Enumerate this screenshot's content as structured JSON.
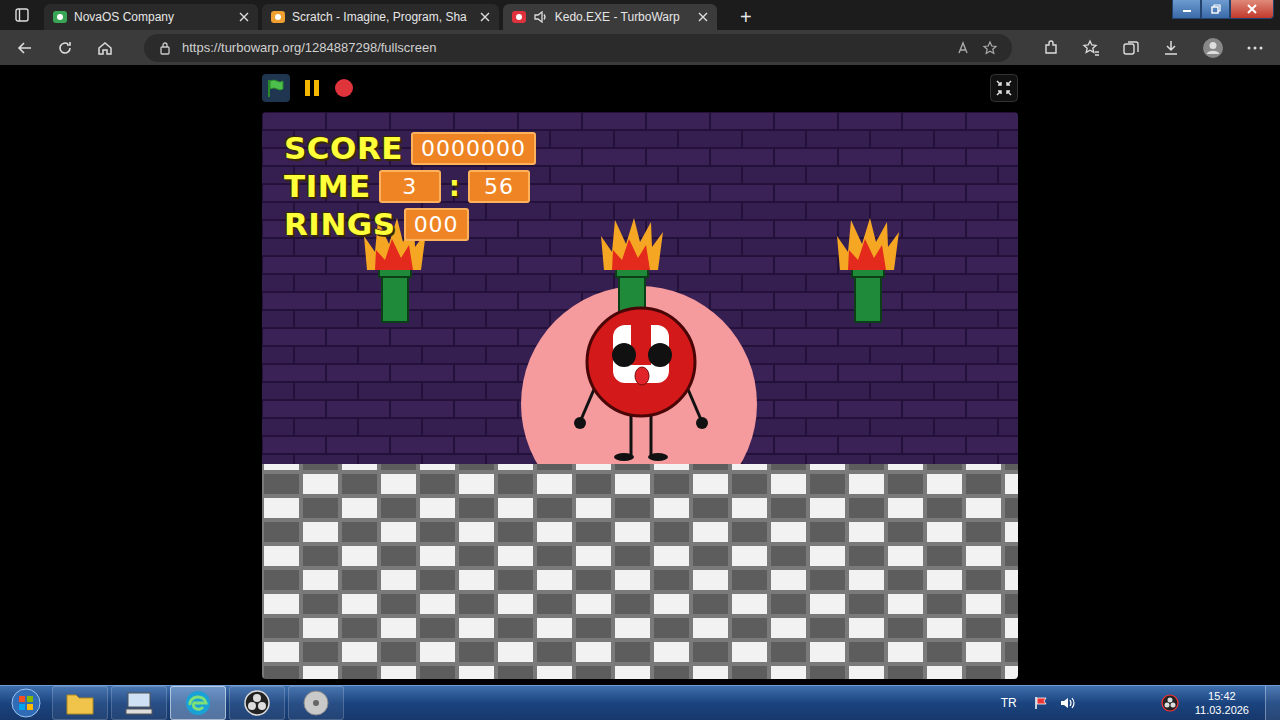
{
  "tabs": [
    {
      "label": "NovaOS Company",
      "selected": false,
      "audio": false,
      "color": "#3aa655"
    },
    {
      "label": "Scratch - Imagine, Program, Sha",
      "selected": false,
      "audio": false,
      "color": "#f0a030"
    },
    {
      "label": "Kedo.EXE - TurboWarp",
      "selected": true,
      "audio": true,
      "color": "#e0323c"
    }
  ],
  "new_tab": "+",
  "address_bar": {
    "url": "https://turbowarp.org/1284887298/fullscreen"
  },
  "game": {
    "hud": [
      {
        "label": "SCORE",
        "values": [
          "0000000"
        ],
        "separator": ""
      },
      {
        "label": "TIME",
        "values": [
          "3",
          "56"
        ],
        "separator": ":"
      },
      {
        "label": "RINGS",
        "values": [
          "000"
        ],
        "separator": ""
      }
    ]
  },
  "taskbar": {
    "language": "TR",
    "time": "15:42",
    "date": "11.03.2026"
  }
}
